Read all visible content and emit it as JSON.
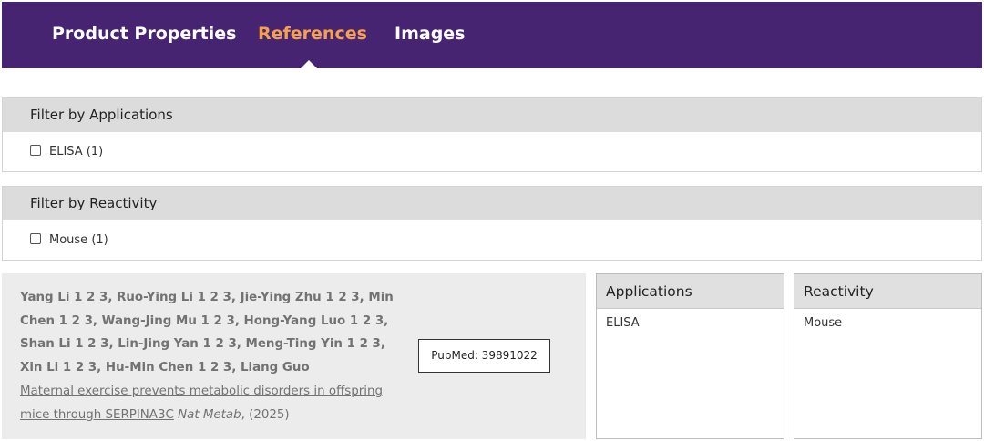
{
  "nav": {
    "tabs": [
      {
        "label": "Product Properties",
        "active": false
      },
      {
        "label": "References",
        "active": true
      },
      {
        "label": "Images",
        "active": false
      }
    ],
    "colors": {
      "background": "#462472",
      "active": "#f5a04a"
    }
  },
  "filters": {
    "applications": {
      "title": "Filter by Applications",
      "option": "ELISA (1)",
      "checked": false
    },
    "reactivity": {
      "title": "Filter by Reactivity",
      "option": "Mouse (1)",
      "checked": false
    }
  },
  "reference": {
    "authors": "Yang Li 1 2 3, Ruo-Ying Li 1 2 3, Jie-Ying Zhu 1 2 3, Min Chen 1 2 3, Wang-Jing Mu 1 2 3, Hong-Yang Luo 1 2 3, Shan Li 1 2 3, Lin-Jing Yan 1 2 3, Meng-Ting Yin 1 2 3, Xin Li 1 2 3, Hu-Min Chen 1 2 3, Liang Guo",
    "title": "Maternal exercise prevents metabolic disorders in offspring mice through SERPINA3C",
    "journal": "Nat Metab",
    "year": ", (2025)",
    "pubmed_label": "PubMed: 39891022",
    "applications": {
      "header": "Applications",
      "value": "ELISA"
    },
    "reactivity": {
      "header": "Reactivity",
      "value": "Mouse"
    }
  }
}
